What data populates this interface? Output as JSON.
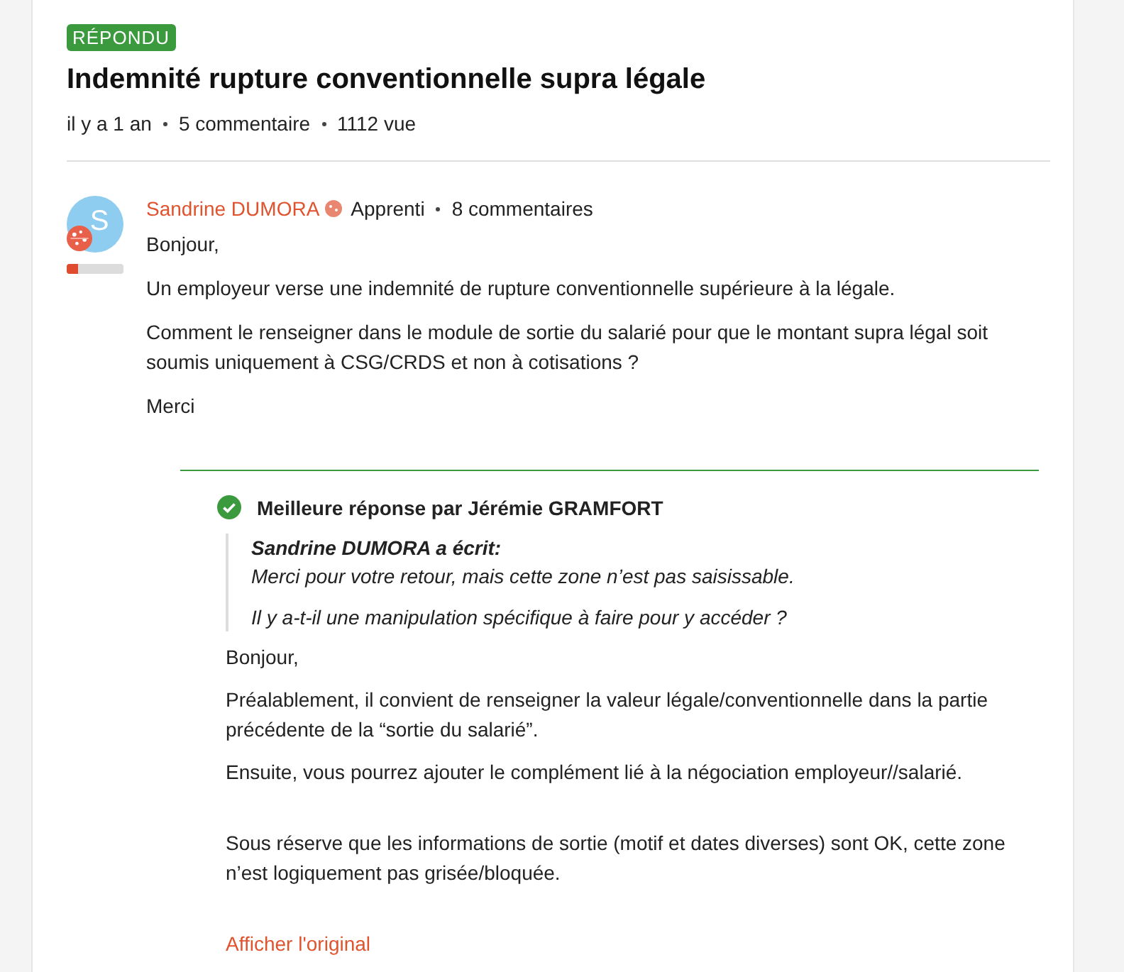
{
  "topic": {
    "status": "RÉPONDU",
    "title": "Indemnité rupture conventionnelle supra légale",
    "meta": [
      "il y a 1 an",
      "5 commentaire",
      "1112 vue"
    ]
  },
  "post": {
    "avatar_letter": "S",
    "rank_meter": {
      "level": 0.2
    },
    "author": "Sandrine DUMORA",
    "rank": "Apprenti",
    "author_stats": "8 commentaires",
    "paragraphs": [
      "Bonjour,",
      "Un employeur verse une indemnité de rupture conventionnelle supérieure à la légale.",
      "Comment le renseigner dans le module de sortie du salarié pour que le montant supra légal soit soumis uniquement à CSG/CRDS et non à cotisations ?",
      "Merci"
    ]
  },
  "best_answer": {
    "heading": "Meilleure réponse par Jérémie GRAMFORT",
    "quote": {
      "author_line": "Sandrine DUMORA a écrit:",
      "paragraphs": [
        "Merci pour votre retour, mais cette zone n’est pas saisissable.",
        "Il y a-t-il une manipulation spécifique à faire pour y accéder ?"
      ]
    },
    "paragraph_groups": [
      [
        "Bonjour,",
        "Préalablement, il convient de renseigner la valeur légale/conventionnelle dans la partie précédente de la “sortie du salarié”.",
        "Ensuite, vous pourrez ajouter le complément lié à la négociation employeur//salarié."
      ],
      [
        "Sous réserve que les informations de sortie (motif et dates diverses) sont OK, cette zone n’est logiquement pas grisée/bloquée."
      ]
    ],
    "show_original_link": "Afficher l'original"
  }
}
